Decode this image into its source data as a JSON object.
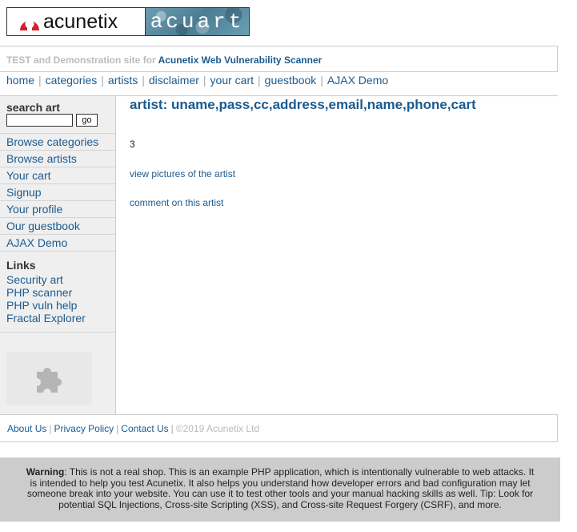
{
  "logo": {
    "brand": "acunetix",
    "site": "acuart"
  },
  "tagline": {
    "prefix": "TEST and Demonstration site for",
    "product": "Acunetix Web Vulnerability Scanner"
  },
  "topnav": {
    "items": [
      "home",
      "categories",
      "artists",
      "disclaimer",
      "your cart",
      "guestbook",
      "AJAX Demo"
    ]
  },
  "sidebar": {
    "search_title": "search art",
    "search_value": "",
    "go_label": "go",
    "menu": [
      "Browse categories",
      "Browse artists",
      "Your cart",
      "Signup",
      "Your profile",
      "Our guestbook",
      "AJAX Demo"
    ],
    "links_title": "Links",
    "links": [
      "Security art",
      "PHP scanner",
      "PHP vuln help",
      "Fractal Explorer"
    ],
    "plugin_icon": "puzzle-piece-icon"
  },
  "main": {
    "heading": "artist: uname,pass,cc,address,email,name,phone,cart",
    "count": "3",
    "view_pictures": "view pictures of the artist",
    "comment": "comment on this artist"
  },
  "footer": {
    "about": "About Us",
    "privacy": "Privacy Policy",
    "contact": "Contact Us",
    "copyright": "©2019 Acunetix Ltd"
  },
  "warning": {
    "label": "Warning",
    "text": ": This is not a real shop. This is an example PHP application, which is intentionally vulnerable to web attacks. It is intended to help you test Acunetix. It also helps you understand how developer errors and bad configuration may let someone break into your website. You can use it to test other tools and your manual hacking skills as well. Tip: Look for potential SQL Injections, Cross-site Scripting (XSS), and Cross-site Request Forgery (CSRF), and more."
  },
  "colors": {
    "link": "#1b5b8f",
    "logo_red": "#d3202a",
    "sidebar_bg": "#efefef",
    "warning_bg": "#cccccc"
  }
}
